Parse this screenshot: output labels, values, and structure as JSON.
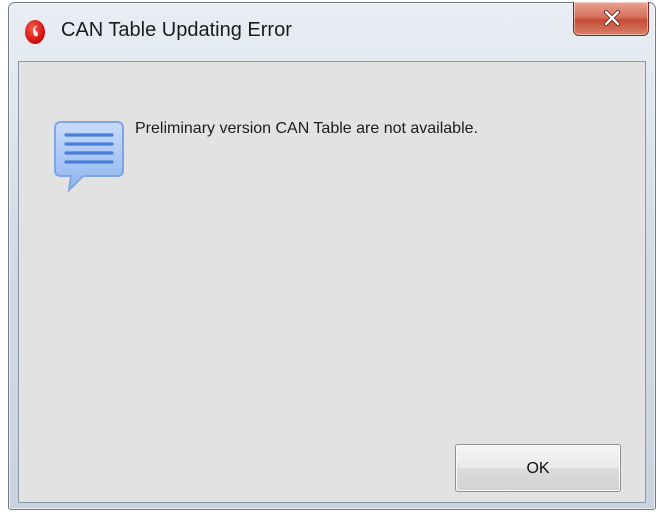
{
  "window": {
    "title": "CAN Table Updating Error",
    "app_icon": "red-circle-logo-icon",
    "close_icon": "close-x-icon"
  },
  "dialog": {
    "icon": "speech-bubble-info-icon",
    "message": "Preliminary version CAN Table are not available.",
    "ok_label": "OK"
  },
  "colors": {
    "close_button": "#c9523b",
    "client_background": "#e2e2e2",
    "app_icon": "#e10000",
    "message_icon": "#6f9fe6"
  }
}
